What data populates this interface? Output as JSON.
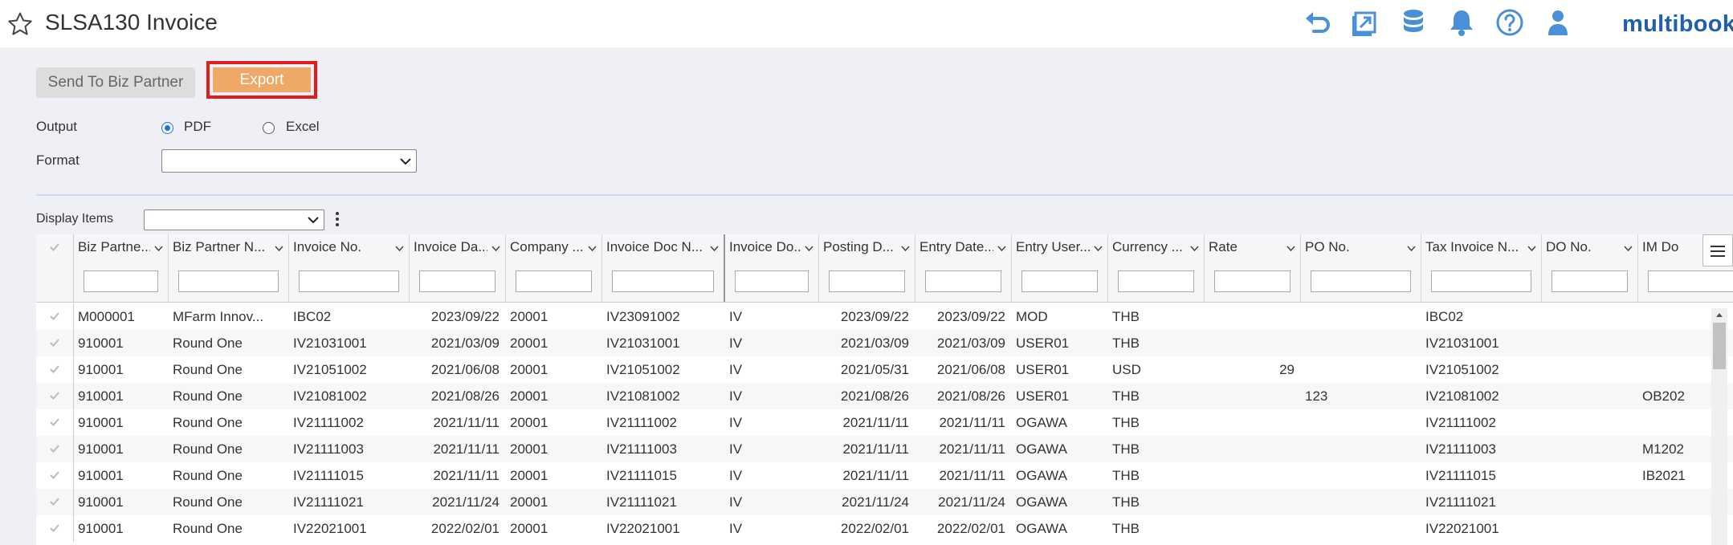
{
  "header": {
    "title": "SLSA130 Invoice",
    "icons": [
      "star-icon",
      "undo-icon",
      "export-window-icon",
      "database-icon",
      "bell-icon",
      "help-icon",
      "user-icon"
    ],
    "brand": "multibook",
    "brand_color": "#1f5fae",
    "icon_color": "#4a90d9"
  },
  "toolbar": {
    "send_label": "Send To Biz Partner",
    "export_label": "Export",
    "export_color": "#f0a868",
    "highlight_color": "#e31b1b"
  },
  "form": {
    "output_label": "Output",
    "output_options": [
      "PDF",
      "Excel"
    ],
    "output_selected": "PDF",
    "format_label": "Format",
    "format_value": "",
    "display_items_label": "Display Items",
    "display_items_value": ""
  },
  "grid": {
    "columns": [
      "Biz Partne...",
      "Biz Partner N...",
      "Invoice No.",
      "Invoice Da...",
      "Company ...",
      "Invoice Doc N...",
      "Invoice Do...",
      "Posting D...",
      "Entry Date...",
      "Entry User...",
      "Currency ...",
      "Rate",
      "PO No.",
      "Tax Invoice N...",
      "DO No.",
      "IM Do"
    ],
    "rows": [
      [
        "M000001",
        "MFarm Innov...",
        "IBC02",
        "2023/09/22",
        "20001",
        "IV23091002",
        "IV",
        "2023/09/22",
        "2023/09/22",
        "MOD",
        "THB",
        "",
        "",
        "IBC02",
        "",
        ""
      ],
      [
        "910001",
        "Round One",
        "IV21031001",
        "2021/03/09",
        "20001",
        "IV21031001",
        "IV",
        "2021/03/09",
        "2021/03/09",
        "USER01",
        "THB",
        "",
        "",
        "IV21031001",
        "",
        ""
      ],
      [
        "910001",
        "Round One",
        "IV21051002",
        "2021/06/08",
        "20001",
        "IV21051002",
        "IV",
        "2021/05/31",
        "2021/06/08",
        "USER01",
        "USD",
        "29",
        "",
        "IV21051002",
        "",
        ""
      ],
      [
        "910001",
        "Round One",
        "IV21081002",
        "2021/08/26",
        "20001",
        "IV21081002",
        "IV",
        "2021/08/26",
        "2021/08/26",
        "USER01",
        "THB",
        "",
        "123",
        "IV21081002",
        "",
        "OB202"
      ],
      [
        "910001",
        "Round One",
        "IV21111002",
        "2021/11/11",
        "20001",
        "IV21111002",
        "IV",
        "2021/11/11",
        "2021/11/11",
        "OGAWA",
        "THB",
        "",
        "",
        "IV21111002",
        "",
        ""
      ],
      [
        "910001",
        "Round One",
        "IV21111003",
        "2021/11/11",
        "20001",
        "IV21111003",
        "IV",
        "2021/11/11",
        "2021/11/11",
        "OGAWA",
        "THB",
        "",
        "",
        "IV21111003",
        "",
        "M1202"
      ],
      [
        "910001",
        "Round One",
        "IV21111015",
        "2021/11/11",
        "20001",
        "IV21111015",
        "IV",
        "2021/11/11",
        "2021/11/11",
        "OGAWA",
        "THB",
        "",
        "",
        "IV21111015",
        "",
        "IB2021"
      ],
      [
        "910001",
        "Round One",
        "IV21111021",
        "2021/11/24",
        "20001",
        "IV21111021",
        "IV",
        "2021/11/24",
        "2021/11/24",
        "OGAWA",
        "THB",
        "",
        "",
        "IV21111021",
        "",
        ""
      ],
      [
        "910001",
        "Round One",
        "IV22021001",
        "2022/02/01",
        "20001",
        "IV22021001",
        "IV",
        "2022/02/01",
        "2022/02/01",
        "OGAWA",
        "THB",
        "",
        "",
        "IV22021001",
        "",
        ""
      ]
    ]
  }
}
